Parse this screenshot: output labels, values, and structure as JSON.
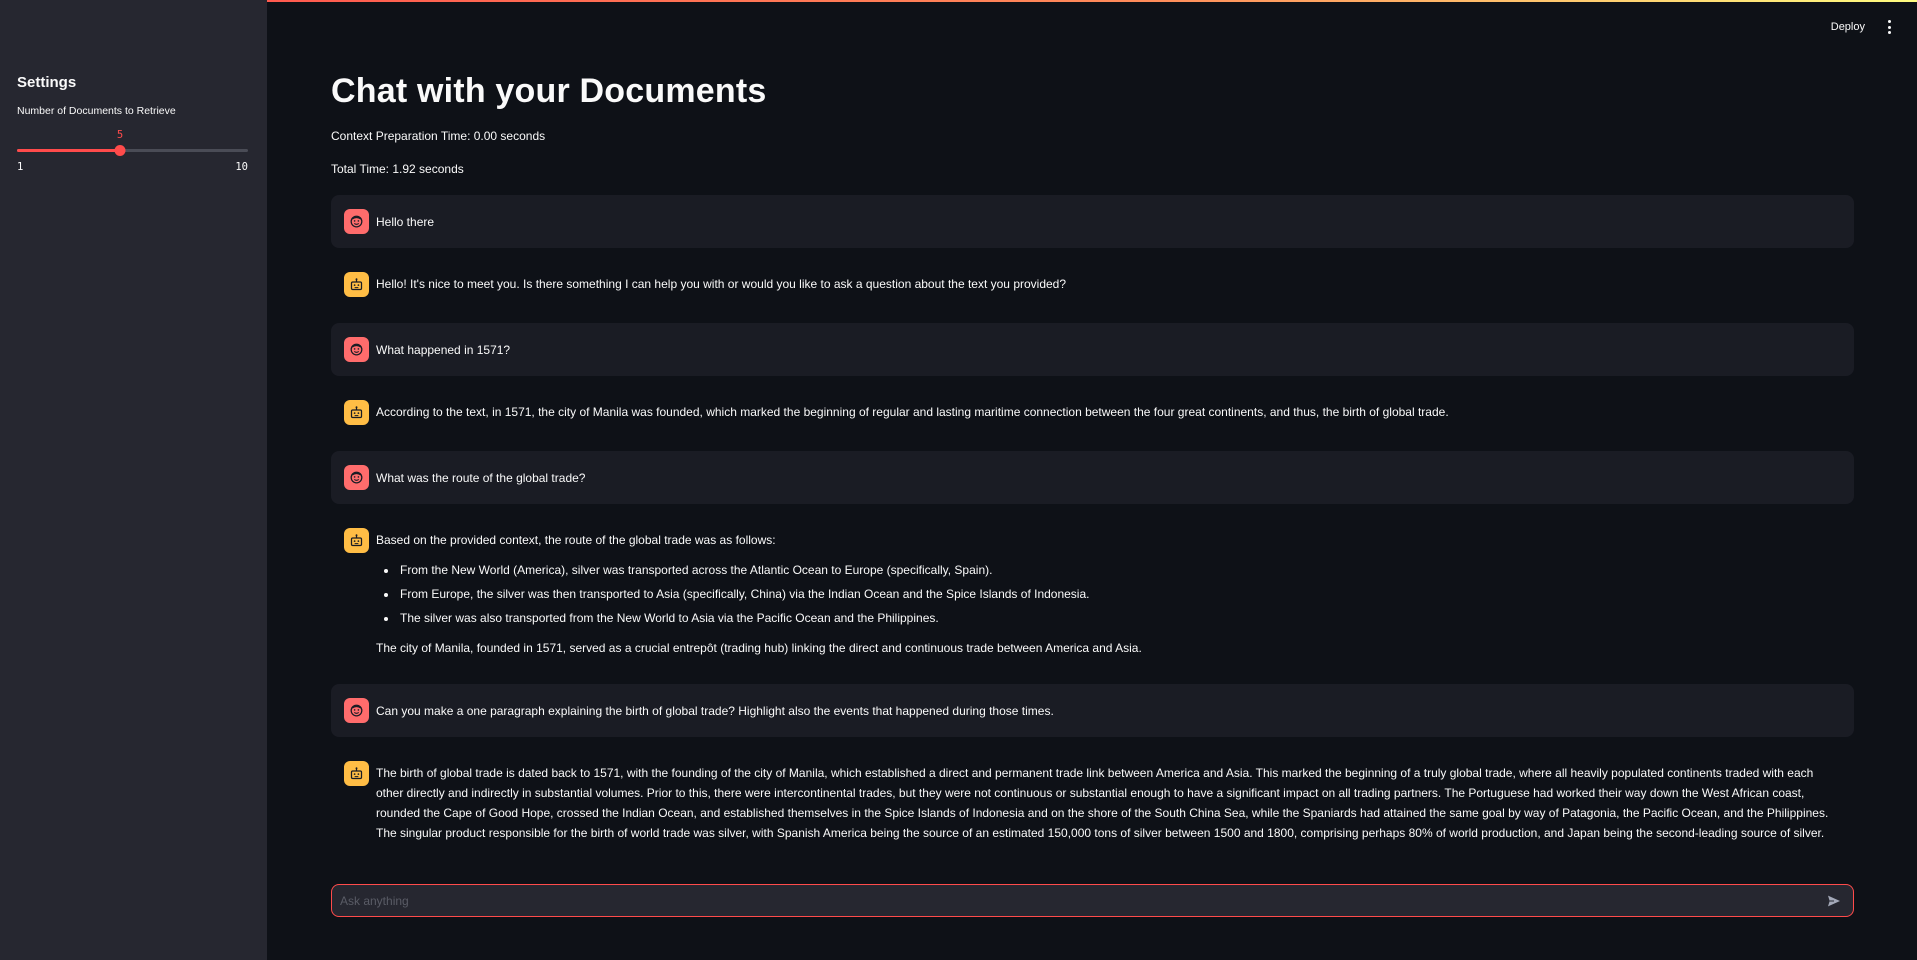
{
  "header": {
    "deploy_label": "Deploy"
  },
  "sidebar": {
    "title": "Settings",
    "slider": {
      "label": "Number of Documents to Retrieve",
      "value": "5",
      "min": "1",
      "max": "10",
      "fraction": 0.444
    }
  },
  "main": {
    "title": "Chat with your Documents",
    "context_time": "Context Preparation Time: 0.00 seconds",
    "total_time": "Total Time: 1.92 seconds"
  },
  "messages": {
    "m0": {
      "text": "Hello there"
    },
    "m1": {
      "text": "Hello! It's nice to meet you. Is there something I can help you with or would you like to ask a question about the text you provided?"
    },
    "m2": {
      "text": "What happened in 1571?"
    },
    "m3": {
      "text": "According to the text, in 1571, the city of Manila was founded, which marked the beginning of regular and lasting maritime connection between the four great continents, and thus, the birth of global trade."
    },
    "m4": {
      "text": "What was the route of the global trade?"
    },
    "m5": {
      "intro": "Based on the provided context, the route of the global trade was as follows:",
      "bullets": [
        "From the New World (America), silver was transported across the Atlantic Ocean to Europe (specifically, Spain).",
        "From Europe, the silver was then transported to Asia (specifically, China) via the Indian Ocean and the Spice Islands of Indonesia.",
        "The silver was also transported from the New World to Asia via the Pacific Ocean and the Philippines."
      ],
      "outro": "The city of Manila, founded in 1571, served as a crucial entrepôt (trading hub) linking the direct and continuous trade between America and Asia."
    },
    "m6": {
      "text": "Can you make a one paragraph explaining the birth of global trade? Highlight also the events that happened during those times."
    },
    "m7": {
      "text": "The birth of global trade is dated back to 1571, with the founding of the city of Manila, which established a direct and permanent trade link between America and Asia. This marked the beginning of a truly global trade, where all heavily populated continents traded with each other directly and indirectly in substantial volumes. Prior to this, there were intercontinental trades, but they were not continuous or substantial enough to have a significant impact on all trading partners. The Portuguese had worked their way down the West African coast, rounded the Cape of Good Hope, crossed the Indian Ocean, and established themselves in the Spice Islands of Indonesia and on the shore of the South China Sea, while the Spaniards had attained the same goal by way of Patagonia, the Pacific Ocean, and the Philippines. The singular product responsible for the birth of world trade was silver, with Spanish America being the source of an estimated 150,000 tons of silver between 1500 and 1800, comprising perhaps 80% of world production, and Japan being the second-leading source of silver."
    }
  },
  "chat_input": {
    "placeholder": "Ask anything"
  },
  "colors": {
    "accent": "#ff4b4b",
    "user_avatar": "#ff6c6c",
    "bot_avatar": "#ffbd45"
  }
}
